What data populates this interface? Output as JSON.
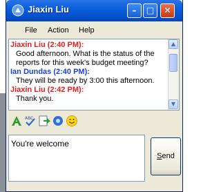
{
  "window": {
    "title": "Jiaxin Liu",
    "buttons": {
      "minimize": "–",
      "maximize": "□",
      "close": "✕"
    }
  },
  "menu": {
    "items": [
      "File",
      "Action",
      "Help"
    ]
  },
  "history": {
    "messages": [
      {
        "sender": "Jiaxin Liu (2:40 PM):",
        "lines": [
          "Good afternoon. What is the status of the",
          "reports for this week's budget meeting?"
        ]
      },
      {
        "sender": "Ian Dundas (2:40 PM):",
        "lines": [
          "They will be ready by 3:00 this afternoon."
        ]
      },
      {
        "sender": "Jiaxin Liu (2:42 PM):",
        "lines": [
          "Thank you."
        ]
      }
    ]
  },
  "toolbar": {
    "icons": [
      "font-icon",
      "spellcheck-icon",
      "send-file-icon",
      "video-icon",
      "emoticon-icon"
    ]
  },
  "compose": {
    "value": "You're welcome"
  },
  "send": {
    "label_underlined": "S",
    "label_rest": "end"
  },
  "colors": {
    "sender_primary": "#e02020",
    "sender_secondary": "#2040d0",
    "titlebar": "#0553d0"
  }
}
